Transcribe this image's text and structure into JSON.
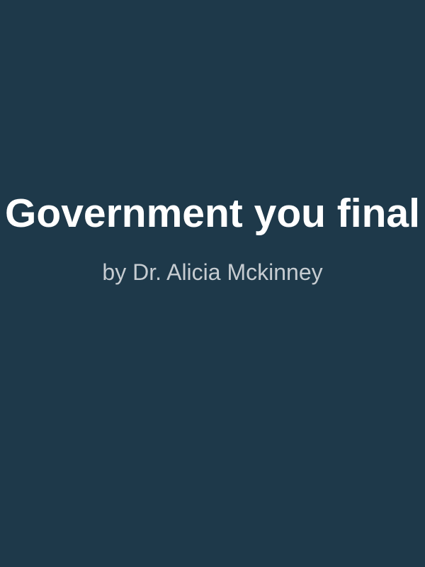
{
  "cover": {
    "title": "Government you final",
    "author": "by Dr. Alicia Mckinney"
  },
  "colors": {
    "background": "#1e394a",
    "title": "#ffffff",
    "author": "#c6ccd1"
  }
}
